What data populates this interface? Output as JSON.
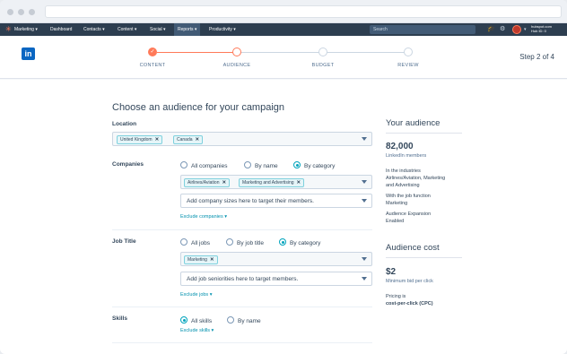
{
  "nav": {
    "items": [
      "Marketing ▾",
      "Dashboard",
      "Contacts ▾",
      "Content ▾",
      "Social ▾",
      "Reports ▾",
      "Productivity ▾"
    ],
    "search_placeholder": "Search",
    "account_line1": "hubspot.com",
    "account_line2": "Hub ID: 0"
  },
  "steps": {
    "labels": [
      "CONTENT",
      "AUDIENCE",
      "BUDGET",
      "REVIEW"
    ],
    "status": [
      "done",
      "current",
      "todo",
      "todo"
    ],
    "counter": "Step 2 of 4"
  },
  "brand": {
    "logo_text": "in"
  },
  "form": {
    "title": "Choose an audience for your campaign",
    "location": {
      "label": "Location",
      "tags": [
        "United Kingdom",
        "Canada"
      ]
    },
    "companies": {
      "label": "Companies",
      "options": [
        "All companies",
        "By name",
        "By category"
      ],
      "selected": 2,
      "tags": [
        "Airlines/Aviation",
        "Marketing and Advertising"
      ],
      "sizes_placeholder": "Add company sizes here to target their members.",
      "exclude_link": "Exclude companies ▾"
    },
    "job_title": {
      "label": "Job Title",
      "options": [
        "All jobs",
        "By job title",
        "By category"
      ],
      "selected": 2,
      "tags": [
        "Marketing"
      ],
      "seniority_placeholder": "Add job seniorities here to target members.",
      "exclude_link": "Exclude jobs ▾"
    },
    "skills": {
      "label": "Skills",
      "options": [
        "All skills",
        "By name"
      ],
      "selected": 0,
      "exclude_link": "Exclude skills ▾"
    }
  },
  "sidebar": {
    "audience_heading": "Your audience",
    "audience_count": "82,000",
    "audience_sub": "LinkedIn members",
    "industries_line1": "In the industries",
    "industries_line2": "Airlines/Aviation, Marketing",
    "industries_line3": "and Advertising",
    "job_line1": "With the job function",
    "job_line2": "Marketing",
    "expansion_line1": "Audience Expansion",
    "expansion_line2": "Enabled",
    "cost_heading": "Audience cost",
    "cost_value": "$2",
    "cost_sub": "Minimum bid per click",
    "pricing_line1": "Pricing is",
    "pricing_line2": "cost-per-click (CPC)"
  },
  "colors": {
    "accent": "#ff7a59",
    "teal": "#00a4bd",
    "nav_bg": "#2d3e50",
    "linkedin": "#0a66c2"
  }
}
